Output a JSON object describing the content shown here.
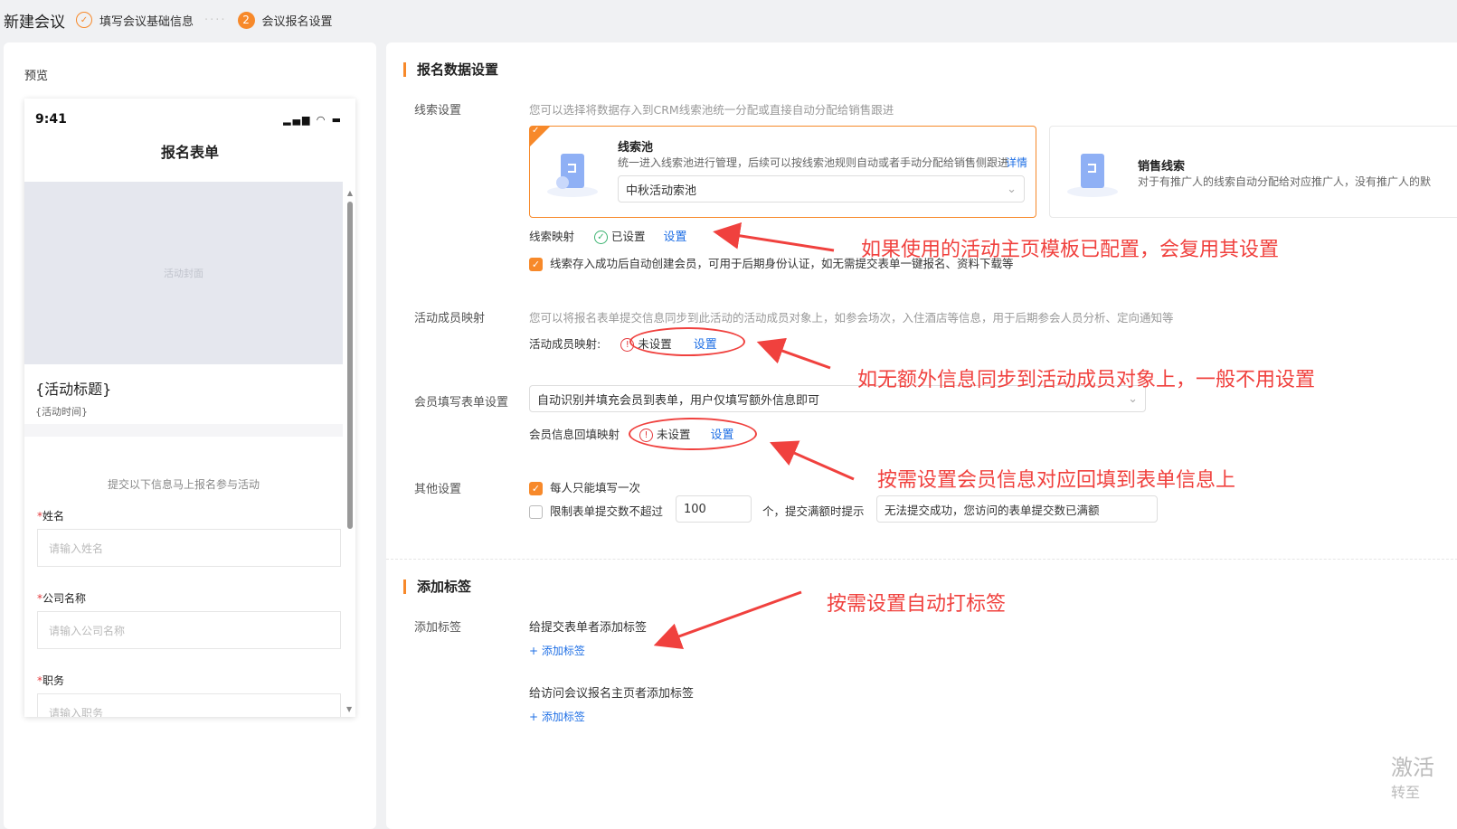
{
  "header": {
    "title": "新建会议",
    "steps": [
      {
        "label": "填写会议基础信息",
        "state": "done"
      },
      {
        "label": "会议报名设置",
        "number": "2",
        "state": "active"
      }
    ]
  },
  "preview": {
    "label": "预览",
    "phone": {
      "time": "9:41",
      "title": "报名表单",
      "cover": "活动封面",
      "activity_title": "{活动标题}",
      "activity_time": "{活动时间}",
      "hint": "提交以下信息马上报名参与活动",
      "fields": [
        {
          "label": "姓名",
          "placeholder": "请输入姓名",
          "required": "*"
        },
        {
          "label": "公司名称",
          "placeholder": "请输入公司名称",
          "required": "*"
        },
        {
          "label": "职务",
          "placeholder": "请输入职务",
          "required": "*"
        }
      ]
    }
  },
  "signup": {
    "section_title": "报名数据设置",
    "lead": {
      "label": "线索设置",
      "desc": "您可以选择将数据存入到CRM线索池统一分配或直接自动分配给销售跟进",
      "card1": {
        "title": "线索池",
        "desc": "统一进入线索池进行管理，后续可以按线索池规则自动或者手动分配给销售侧跟进",
        "detail_link": "详情",
        "select_value": "中秋活动索池",
        "selected": true
      },
      "card2": {
        "title": "销售线索",
        "desc": "对于有推广人的线索自动分配给对应推广人，没有推广人的默"
      },
      "mapping_label": "线索映射",
      "mapping_status": "已设置",
      "mapping_link": "设置",
      "auto_member_checkbox": {
        "label": "线索存入成功后自动创建会员，可用于后期身份认证，如无需提交表单一键报名、资料下载等",
        "checked": true
      }
    },
    "member_map": {
      "label": "活动成员映射",
      "desc": "您可以将报名表单提交信息同步到此活动的活动成员对象上，如参会场次，入住酒店等信息，用于后期参会人员分析、定向通知等",
      "field_label": "活动成员映射:",
      "status": "未设置",
      "link": "设置"
    },
    "member_fill": {
      "label": "会员填写表单设置",
      "select_value": "自动识别并填充会员到表单，用户仅填写额外信息即可",
      "backfill_label": "会员信息回填映射",
      "status": "未设置",
      "link": "设置"
    },
    "other": {
      "label": "其他设置",
      "once": {
        "label": "每人只能填写一次",
        "checked": true
      },
      "limit": {
        "label": "限制表单提交数不超过",
        "checked": false,
        "value": "100",
        "suffix": "个，提交满额时提示",
        "message": "无法提交成功，您访问的表单提交数已满额"
      }
    }
  },
  "tags": {
    "section_title": "添加标签",
    "label": "添加标签",
    "submitter_label": "给提交表单者添加标签",
    "submitter_link": "+ 添加标签",
    "visitor_label": "给访问会议报名主页者添加标签",
    "visitor_link": "+ 添加标签"
  },
  "annotations": [
    "如果使用的活动主页模板已配置，会复用其设置",
    "如无额外信息同步到活动成员对象上，一般不用设置",
    "按需设置会员信息对应回填到表单信息上",
    "按需设置自动打标签"
  ],
  "watermark": {
    "line1": "激活",
    "line2": "转至"
  },
  "colors": {
    "accent": "#f7892a",
    "link": "#1f6fe5",
    "annotation": "#f0413e",
    "success": "#3cb371"
  }
}
